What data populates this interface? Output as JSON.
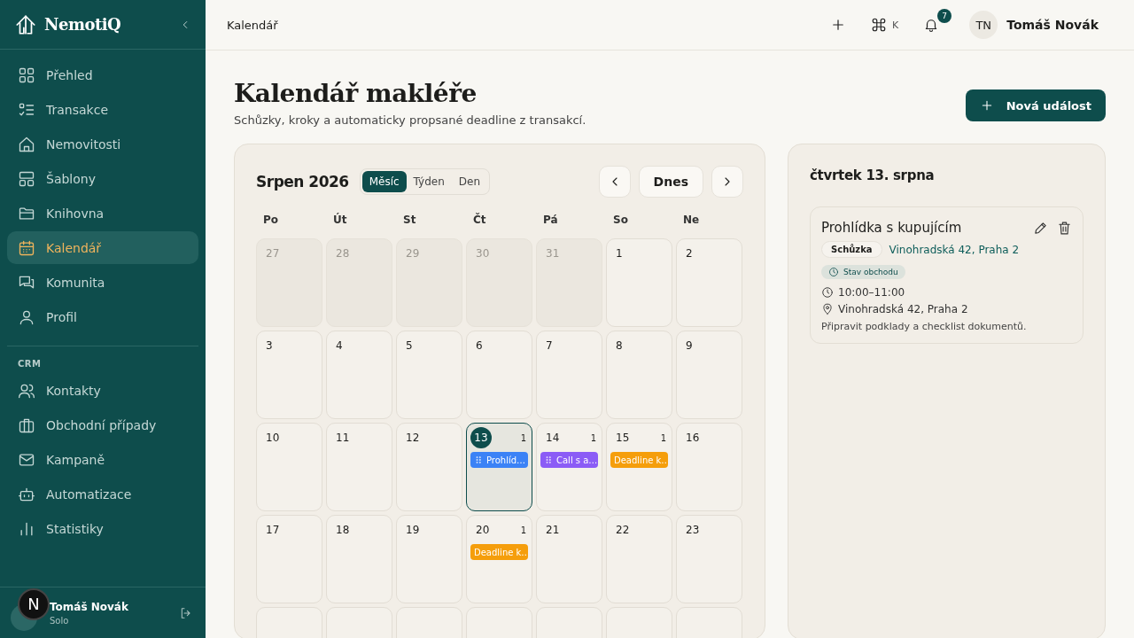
{
  "sidebar": {
    "logo": "NemotiQ",
    "nav": [
      {
        "label": "Přehled",
        "selected": false
      },
      {
        "label": "Transakce",
        "selected": false
      },
      {
        "label": "Nemovitosti",
        "selected": false
      },
      {
        "label": "Šablony",
        "selected": false
      },
      {
        "label": "Knihovna",
        "selected": false
      },
      {
        "label": "Kalendář",
        "selected": true
      },
      {
        "label": "Komunita",
        "selected": false
      },
      {
        "label": "Profil",
        "selected": false
      }
    ],
    "section_label": "CRM",
    "crm": [
      {
        "label": "Kontakty",
        "selected": false
      },
      {
        "label": "Obchodní případy",
        "selected": false
      },
      {
        "label": "Kampaně",
        "selected": false
      },
      {
        "label": "Automatizace",
        "selected": false
      },
      {
        "label": "Statistiky",
        "selected": false
      }
    ],
    "user": {
      "name": "Tomáš Novák",
      "plan": "Solo",
      "overlay_badge": "N"
    }
  },
  "topbar": {
    "breadcrumb": "Kalendář",
    "shortcut_key": "K",
    "notifications": "7",
    "avatar_initials": "TN",
    "user_name": "Tomáš Novák"
  },
  "header": {
    "title": "Kalendář makléře",
    "subtitle": "Schůzky, kroky a automaticky propsané deadline z transakcí.",
    "new_button": "Nová událost"
  },
  "calendar": {
    "month": "Srpen 2026",
    "views": [
      {
        "label": "Měsíc",
        "selected": true
      },
      {
        "label": "Týden",
        "selected": false
      },
      {
        "label": "Den",
        "selected": false
      }
    ],
    "today_button": "Dnes",
    "weekdays": [
      "Po",
      "Út",
      "St",
      "Čt",
      "Pá",
      "So",
      "Ne"
    ],
    "weeks": [
      [
        {
          "day": "27",
          "outside": true
        },
        {
          "day": "28",
          "outside": true
        },
        {
          "day": "29",
          "outside": true
        },
        {
          "day": "30",
          "outside": true
        },
        {
          "day": "31",
          "outside": true
        },
        {
          "day": "1",
          "outside": false
        },
        {
          "day": "2",
          "outside": false
        }
      ],
      [
        {
          "day": "3",
          "outside": false
        },
        {
          "day": "4",
          "outside": false
        },
        {
          "day": "5",
          "outside": false
        },
        {
          "day": "6",
          "outside": false
        },
        {
          "day": "7",
          "outside": false
        },
        {
          "day": "8",
          "outside": false
        },
        {
          "day": "9",
          "outside": false
        }
      ],
      [
        {
          "day": "10",
          "outside": false
        },
        {
          "day": "11",
          "outside": false
        },
        {
          "day": "12",
          "outside": false
        },
        {
          "day": "13",
          "outside": false,
          "selected": true,
          "count": "1",
          "events": [
            {
              "title": "Prohlíd…",
              "color": "#3b82f6",
              "draggable": true
            }
          ]
        },
        {
          "day": "14",
          "outside": false,
          "count": "1",
          "events": [
            {
              "title": "Call s a…",
              "color": "#8b5cf6",
              "draggable": true
            }
          ]
        },
        {
          "day": "15",
          "outside": false,
          "count": "1",
          "events": [
            {
              "title": "Deadline k…",
              "color": "#f59e0b",
              "draggable": false
            }
          ]
        },
        {
          "day": "16",
          "outside": false
        }
      ],
      [
        {
          "day": "17",
          "outside": false
        },
        {
          "day": "18",
          "outside": false
        },
        {
          "day": "19",
          "outside": false
        },
        {
          "day": "20",
          "outside": false,
          "count": "1",
          "events": [
            {
              "title": "Deadline k…",
              "color": "#f59e0b",
              "draggable": false
            }
          ]
        },
        {
          "day": "21",
          "outside": false
        },
        {
          "day": "22",
          "outside": false
        },
        {
          "day": "23",
          "outside": false
        }
      ],
      [
        {
          "outside": false
        },
        {
          "outside": false
        },
        {
          "outside": false
        },
        {
          "outside": false
        },
        {
          "outside": false
        },
        {
          "outside": false
        },
        {
          "outside": false
        }
      ]
    ]
  },
  "day_panel": {
    "title": "čtvrtek 13. srpna",
    "event": {
      "title": "Prohlídka s kupujícím",
      "type_tag": "Schůzka",
      "link": "Vinohradská 42, Praha 2",
      "status_tag": "Stav obchodu",
      "time": "10:00–11:00",
      "location": "Vinohradská 42, Praha 2",
      "note": "Připravit podklady a checklist dokumentů."
    }
  }
}
